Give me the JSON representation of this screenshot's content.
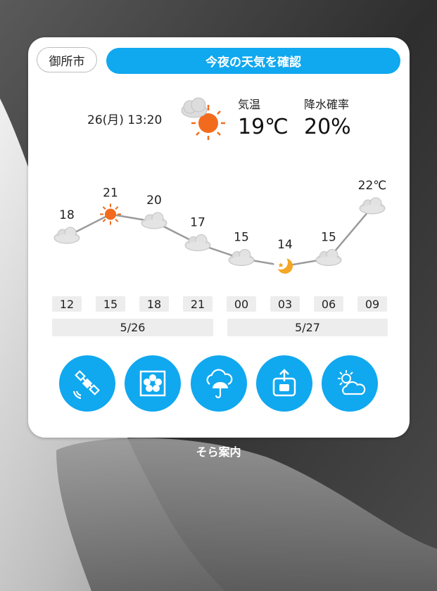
{
  "widget": {
    "location_label": "御所市",
    "main_button_label": "今夜の天気を確認",
    "datetime": "26(月) 13:20",
    "current_icon": "sun-behind-cloud-icon",
    "temp_label": "気温",
    "temp_value": "19℃",
    "precip_label": "降水確率",
    "precip_value": "20%"
  },
  "forecast": {
    "temps": [
      "18",
      "21",
      "20",
      "17",
      "15",
      "14",
      "15",
      "22℃"
    ],
    "icons": [
      "cloud-icon",
      "sun-icon",
      "cloud-icon",
      "cloud-icon",
      "cloud-icon",
      "moon-icon",
      "cloud-icon",
      "cloud-icon"
    ],
    "hours": [
      "12",
      "15",
      "18",
      "21",
      "00",
      "03",
      "06",
      "09"
    ],
    "dates": [
      "5/26",
      "5/27"
    ]
  },
  "actions": [
    {
      "name": "satellite",
      "icon": "satellite-icon"
    },
    {
      "name": "weather-map",
      "icon": "flower-map-icon"
    },
    {
      "name": "rain-umbrella",
      "icon": "cloud-umbrella-icon"
    },
    {
      "name": "share-photo",
      "icon": "camera-upload-icon"
    },
    {
      "name": "sun-cloud",
      "icon": "sun-cloud-icon"
    }
  ],
  "app_caption": "そら案内",
  "colors": {
    "accent": "#10a8ef",
    "line": "#9a9a9a",
    "sun": "#f26b1d",
    "moon": "#f5a623"
  }
}
